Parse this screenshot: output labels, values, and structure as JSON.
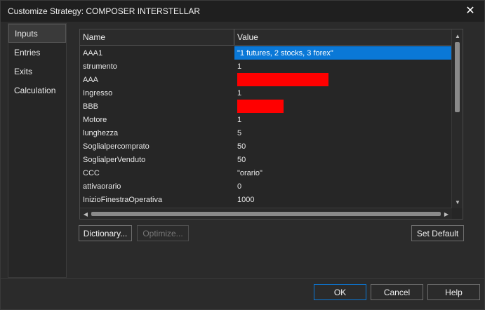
{
  "window": {
    "title": "Customize Strategy: COMPOSER INTERSTELLAR",
    "close_glyph": "✕"
  },
  "sidebar": {
    "items": [
      {
        "label": "Inputs",
        "active": true
      },
      {
        "label": "Entries",
        "active": false
      },
      {
        "label": "Exits",
        "active": false
      },
      {
        "label": "Calculation",
        "active": false
      }
    ]
  },
  "grid": {
    "headers": {
      "name": "Name",
      "value": "Value"
    },
    "rows": [
      {
        "name": "AAA1",
        "value": "\"1 futures, 2 stocks, 3 forex\"",
        "selected": true
      },
      {
        "name": "strumento",
        "value": "1"
      },
      {
        "name": "AAA",
        "value": ""
      },
      {
        "name": "Ingresso",
        "value": "1"
      },
      {
        "name": "BBB",
        "value": ""
      },
      {
        "name": "Motore",
        "value": "1"
      },
      {
        "name": "lunghezza",
        "value": "5"
      },
      {
        "name": "Soglialpercomprato",
        "value": "50"
      },
      {
        "name": "SoglialperVenduto",
        "value": "50"
      },
      {
        "name": "CCC",
        "value": "\"orario\""
      },
      {
        "name": "attivaorario",
        "value": "0"
      },
      {
        "name": "InizioFinestraOperativa",
        "value": "1000"
      }
    ],
    "redaction_color": "#ff0000"
  },
  "buttons": {
    "dictionary": "Dictionary...",
    "optimize": "Optimize...",
    "set_default": "Set Default",
    "ok": "OK",
    "cancel": "Cancel",
    "help": "Help"
  },
  "colors": {
    "selection": "#0a78d7",
    "background": "#2b2b2b"
  }
}
